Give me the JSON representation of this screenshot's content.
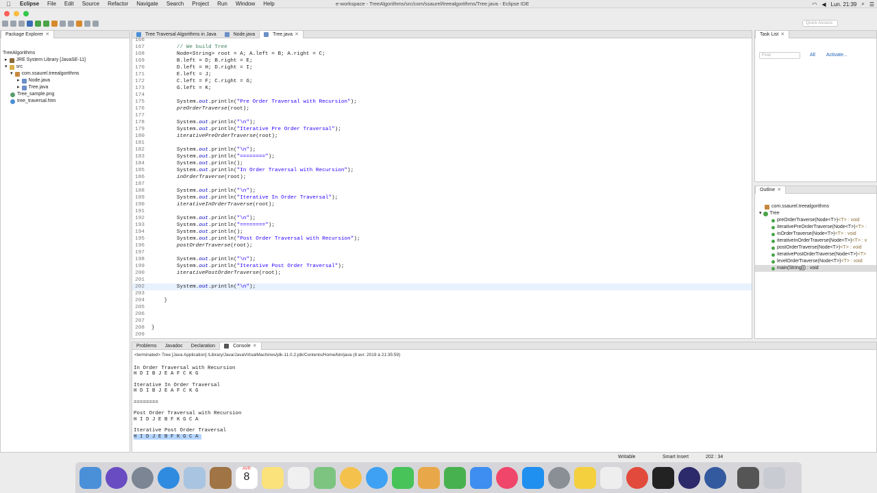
{
  "menubar": {
    "app": "Eclipse",
    "items": [
      "File",
      "Edit",
      "Source",
      "Refactor",
      "Navigate",
      "Search",
      "Project",
      "Run",
      "Window",
      "Help"
    ],
    "window_title": "e-workspace - TreeAlgorithms/src/com/ssaurel/treealgorithms/Tree.java - Eclipse IDE",
    "clock": "Lun. 21:39"
  },
  "toolbar": {
    "quick_access": "Quick Access"
  },
  "package_explorer": {
    "tab": "Package Explorer",
    "items": [
      {
        "label": "TreeAlgorithms",
        "icon": "project-icon"
      },
      {
        "label": "JRE System Library [JavaSE-11]",
        "icon": "library-icon"
      },
      {
        "label": "src",
        "icon": "folder-icon"
      },
      {
        "label": "com.ssaurel.treealgorithms",
        "icon": "package-icon"
      },
      {
        "label": "Node.java",
        "icon": "java-file-icon"
      },
      {
        "label": "Tree.java",
        "icon": "java-file-icon"
      },
      {
        "label": "Tree_sample.png",
        "icon": "image-file-icon"
      },
      {
        "label": "tree_traversal.htm",
        "icon": "html-file-icon"
      }
    ]
  },
  "editor": {
    "tabs": [
      "Tree Traversal Algorithms in Java",
      "Node.java",
      "Tree.java"
    ],
    "active_tab": 2,
    "lines": [
      {
        "n": "166",
        "t": ""
      },
      {
        "n": "167",
        "t": "        // We build Tree"
      },
      {
        "n": "168",
        "t": "        Node<String> root = A; A.left = B; A.right = C;"
      },
      {
        "n": "169",
        "t": "        B.left = D; B.right = E;"
      },
      {
        "n": "170",
        "t": "        D.left = H; D.right = I;"
      },
      {
        "n": "171",
        "t": "        E.left = J;"
      },
      {
        "n": "172",
        "t": "        C.left = F; C.right = G;"
      },
      {
        "n": "173",
        "t": "        G.left = K;"
      },
      {
        "n": "174",
        "t": ""
      },
      {
        "n": "175",
        "t": "        System.out.println(\"Pre Order Traversal with Recursion\");"
      },
      {
        "n": "176",
        "t": "        preOrderTraverse(root);"
      },
      {
        "n": "177",
        "t": ""
      },
      {
        "n": "178",
        "t": "        System.out.println(\"\\n\");"
      },
      {
        "n": "179",
        "t": "        System.out.println(\"Iterative Pre Order Traversal\");"
      },
      {
        "n": "180",
        "t": "        iterativePreOrderTraverse(root);"
      },
      {
        "n": "181",
        "t": ""
      },
      {
        "n": "182",
        "t": "        System.out.println(\"\\n\");"
      },
      {
        "n": "183",
        "t": "        System.out.println(\"========\");"
      },
      {
        "n": "184",
        "t": "        System.out.println();"
      },
      {
        "n": "185",
        "t": "        System.out.println(\"In Order Traversal with Recursion\");"
      },
      {
        "n": "186",
        "t": "        inOrderTraverse(root);"
      },
      {
        "n": "187",
        "t": ""
      },
      {
        "n": "188",
        "t": "        System.out.println(\"\\n\");"
      },
      {
        "n": "189",
        "t": "        System.out.println(\"Iterative In Order Traversal\");"
      },
      {
        "n": "190",
        "t": "        iterativeInOrderTraverse(root);"
      },
      {
        "n": "191",
        "t": ""
      },
      {
        "n": "192",
        "t": "        System.out.println(\"\\n\");"
      },
      {
        "n": "193",
        "t": "        System.out.println(\"========\");"
      },
      {
        "n": "194",
        "t": "        System.out.println();"
      },
      {
        "n": "195",
        "t": "        System.out.println(\"Post Order Traversal with Recursion\");"
      },
      {
        "n": "196",
        "t": "        postOrderTraverse(root);"
      },
      {
        "n": "197",
        "t": ""
      },
      {
        "n": "198",
        "t": "        System.out.println(\"\\n\");"
      },
      {
        "n": "199",
        "t": "        System.out.println(\"Iterative Post Order Traversal\");"
      },
      {
        "n": "200",
        "t": "        iterativePostOrderTraverse(root);"
      },
      {
        "n": "201",
        "t": ""
      },
      {
        "n": "202",
        "t": "        System.out.println(\"\\n\");"
      },
      {
        "n": "203",
        "t": ""
      },
      {
        "n": "204",
        "t": "    }"
      },
      {
        "n": "205",
        "t": ""
      },
      {
        "n": "206",
        "t": ""
      },
      {
        "n": "207",
        "t": ""
      },
      {
        "n": "208",
        "t": "}"
      },
      {
        "n": "209",
        "t": ""
      }
    ],
    "current_line": "202"
  },
  "task_list": {
    "tab": "Task List",
    "find_placeholder": "Find",
    "all": "All",
    "activate": "Activate..."
  },
  "outline": {
    "tab": "Outline",
    "package": "com.ssaurel.treealgorithms",
    "class": "Tree",
    "methods": [
      {
        "name": "preOrderTraverse(Node<T>)",
        "type": "<T> : void"
      },
      {
        "name": "iterativePreOrderTraverse(Node<T>)",
        "type": "<T> :"
      },
      {
        "name": "inOrderTraverse(Node<T>)",
        "type": "<T> : void"
      },
      {
        "name": "iterativeInOrderTraverse(Node<T>)",
        "type": "<T> : v"
      },
      {
        "name": "postOrderTraverse(Node<T>)",
        "type": "<T> : void"
      },
      {
        "name": "iterativePostOrderTraverse(Node<T>)",
        "type": "<T>"
      },
      {
        "name": "levelOrderTraverse(Node<T>)",
        "type": "<T> : void"
      },
      {
        "name": "main(String[]) : void",
        "type": ""
      }
    ]
  },
  "console": {
    "tabs": [
      "Problems",
      "Javadoc",
      "Declaration",
      "Console"
    ],
    "active_tab": 3,
    "header": "<terminated> Tree [Java Application] /Library/Java/JavaVirtualMachines/jdk-11.0.2.jdk/Contents/Home/bin/java (8 avr. 2019 à 21:35:59)",
    "output": "In Order Traversal with Recursion\nH D I B J E A F C K G \n\nIterative In Order Traversal\nH D I B J E A F C K G \n\n========\n\nPost Order Traversal with Recursion\nH I D J E B F K G C A \n\nIterative Post Order Traversal\n",
    "selected": "H I D J E B F K G C A "
  },
  "status": {
    "writable": "Writable",
    "insert": "Smart Insert",
    "position": "202 : 34"
  },
  "dock": {
    "calendar_day": "8",
    "calendar_month": "AVR"
  },
  "colors": {
    "keyword": "#7f0055",
    "string": "#2a00ff",
    "field": "#0000c0",
    "highlight": "#e8f2fe",
    "selection": "#b4d5fe"
  }
}
